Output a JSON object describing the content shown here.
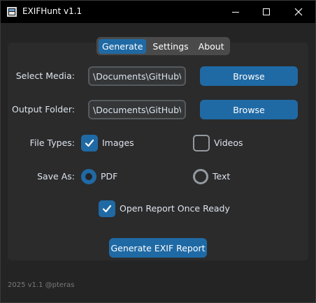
{
  "window": {
    "title": "EXIFHunt v1.1",
    "icon": "app-icon"
  },
  "tabs": [
    {
      "label": "Generate",
      "active": true
    },
    {
      "label": "Settings",
      "active": false
    },
    {
      "label": "About",
      "active": false
    }
  ],
  "form": {
    "select_media": {
      "label": "Select Media:",
      "value": "\\Documents\\GitHub\\M",
      "button": "Browse"
    },
    "output_folder": {
      "label": "Output Folder:",
      "value": "\\Documents\\GitHub\\M",
      "button": "Browse"
    },
    "file_types": {
      "label": "File Types:",
      "options": [
        {
          "label": "Images",
          "checked": true
        },
        {
          "label": "Videos",
          "checked": false
        }
      ]
    },
    "save_as": {
      "label": "Save As:",
      "options": [
        {
          "label": "PDF",
          "selected": true
        },
        {
          "label": "Text",
          "selected": false
        }
      ]
    },
    "open_report": {
      "label": "Open Report Once Ready",
      "checked": true
    },
    "generate_button": "Generate EXIF Report"
  },
  "footer": "2025 v1.1 @pteras",
  "colors": {
    "accent": "#1f6aa5",
    "background": "#242424",
    "panel": "#2b2b2b",
    "titlebar": "#000000"
  }
}
